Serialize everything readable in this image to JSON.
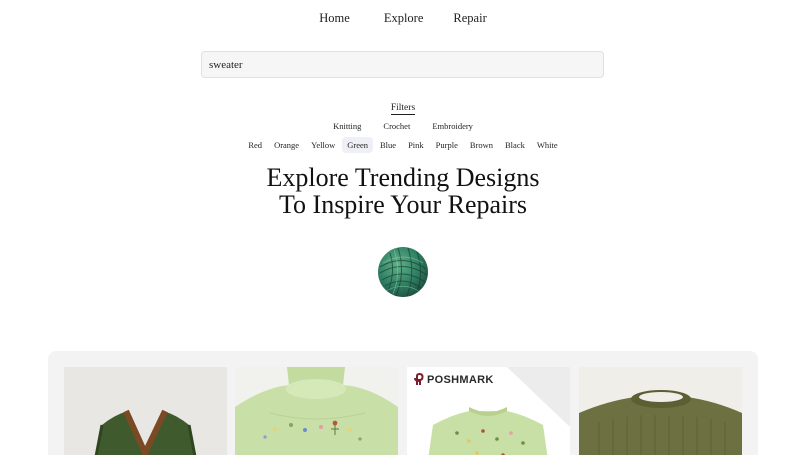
{
  "nav": {
    "items": [
      {
        "label": "Home"
      },
      {
        "label": "Explore"
      },
      {
        "label": "Repair"
      }
    ]
  },
  "search": {
    "value": "sweater"
  },
  "filters": {
    "title": "Filters",
    "crafts": [
      "Knitting",
      "Crochet",
      "Embroidery"
    ],
    "colors": [
      "Red",
      "Orange",
      "Yellow",
      "Green",
      "Blue",
      "Pink",
      "Purple",
      "Brown",
      "Black",
      "White"
    ],
    "active_color": "Green"
  },
  "headline": {
    "line1": "Explore Trending Designs",
    "line2": "To Inspire Your Repairs"
  },
  "gallery": {
    "cards": [
      {
        "name": "green-cardigan"
      },
      {
        "name": "mint-embroidered-sweater"
      },
      {
        "name": "poshmark-embroidered-sweater",
        "badge": "POSHMARK"
      },
      {
        "name": "olive-knit-sweater"
      }
    ]
  },
  "colors": {
    "accent_chip_bg": "#eef0f6",
    "search_bg": "#f6f6f6",
    "gallery_bg": "#f3f3f3"
  }
}
